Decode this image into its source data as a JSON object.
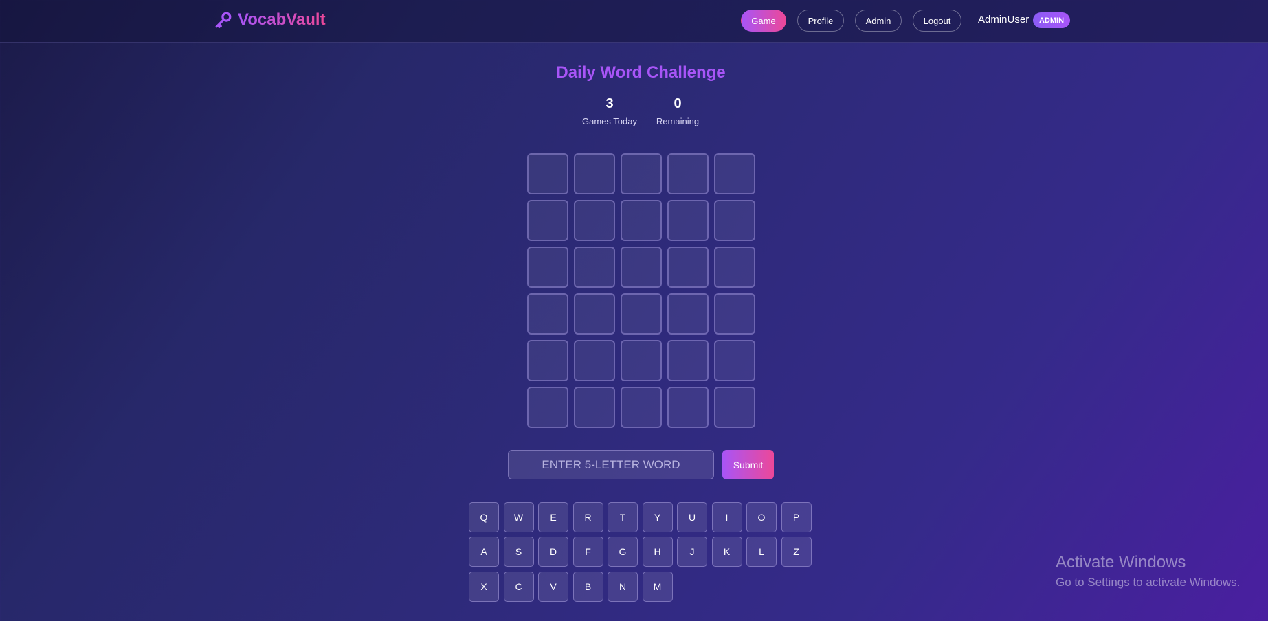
{
  "header": {
    "logo_text": "VocabVault",
    "logo_icon": "key-icon",
    "nav": [
      {
        "label": "Game",
        "active": true
      },
      {
        "label": "Profile",
        "active": false
      },
      {
        "label": "Admin",
        "active": false
      },
      {
        "label": "Logout",
        "active": false
      }
    ],
    "username": "AdminUser",
    "role_badge": "ADMIN"
  },
  "game": {
    "title": "Daily Word Challenge",
    "stats": [
      {
        "value": "3",
        "label": "Games Today"
      },
      {
        "value": "0",
        "label": "Remaining"
      }
    ],
    "grid": {
      "rows": 6,
      "cols": 5
    },
    "input_placeholder": "ENTER 5-LETTER WORD",
    "submit_label": "Submit"
  },
  "keyboard": {
    "rows": [
      [
        "Q",
        "W",
        "E",
        "R",
        "T",
        "Y",
        "U",
        "I",
        "O",
        "P"
      ],
      [
        "A",
        "S",
        "D",
        "F",
        "G",
        "H",
        "J",
        "K",
        "L",
        "Z"
      ],
      [
        "X",
        "C",
        "V",
        "B",
        "N",
        "M"
      ]
    ]
  },
  "watermark": {
    "title": "Activate Windows",
    "subtitle": "Go to Settings to activate Windows."
  },
  "colors": {
    "accent_purple": "#a855f7",
    "accent_pink": "#ec4899",
    "background_start": "#1b1a48",
    "background_end": "#4a1fa0"
  }
}
